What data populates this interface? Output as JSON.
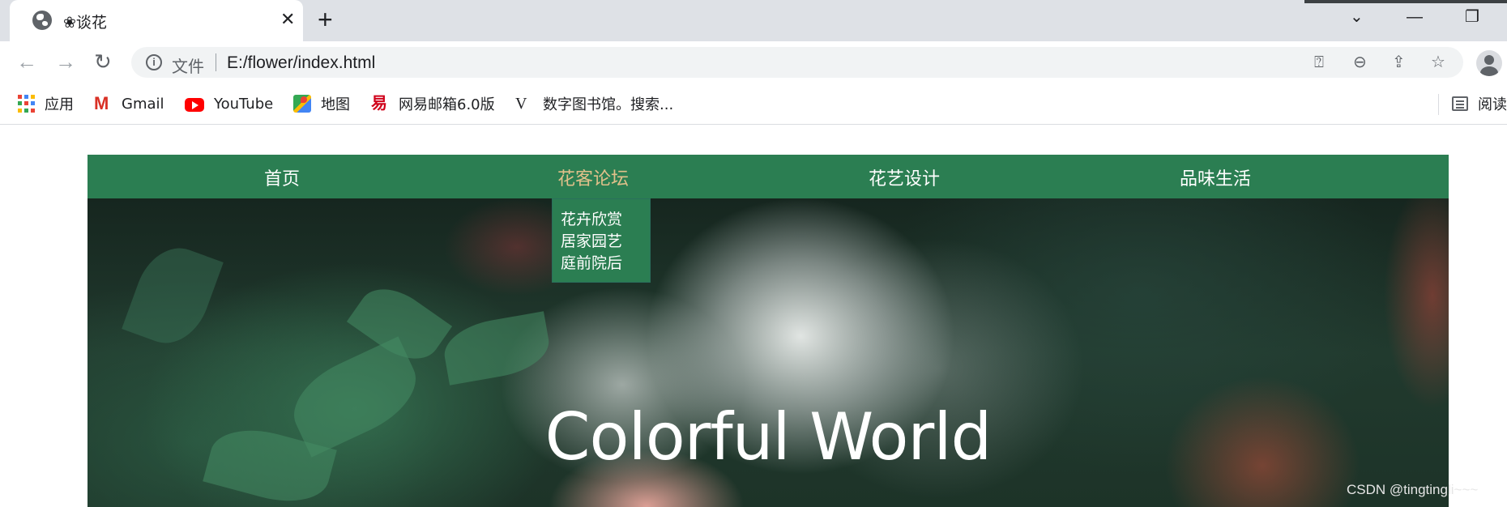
{
  "browser": {
    "tab": {
      "title": "❀谈花",
      "close": "✕"
    },
    "new_tab": "+",
    "window_controls": {
      "tab_search": "⌄",
      "minimize": "—",
      "restore": "❐"
    },
    "nav": {
      "back": "←",
      "forward": "→",
      "reload": "↻"
    },
    "address": {
      "info": "i",
      "file_label": "文件",
      "url": "E:/flower/index.html"
    },
    "omnibox_icons": {
      "translate": "⍰",
      "zoom": "⊖",
      "share": "⇪",
      "bookmark": "☆"
    },
    "bookmarks": [
      {
        "label": "应用",
        "icon": "apps-grid-icon"
      },
      {
        "label": "Gmail",
        "icon": "gmail-icon",
        "glyph": "M"
      },
      {
        "label": "YouTube",
        "icon": "youtube-icon"
      },
      {
        "label": "地图",
        "icon": "maps-icon"
      },
      {
        "label": "网易邮箱6.0版",
        "icon": "mail163-icon",
        "glyph": "易"
      },
      {
        "label": "数字图书馆。搜索...",
        "icon": "library-icon",
        "glyph": "V"
      }
    ],
    "reading_list": {
      "label": "阅读",
      "icon": "reading-list-icon"
    },
    "app_grid_colors": [
      "#ea4335",
      "#4285f4",
      "#fbbc04",
      "#34a853",
      "#ea4335",
      "#4285f4",
      "#fbbc04",
      "#34a853",
      "#ea4335"
    ]
  },
  "site": {
    "nav": [
      {
        "label": "首页",
        "active": false
      },
      {
        "label": "花客论坛",
        "active": true
      },
      {
        "label": "花艺设计",
        "active": false
      },
      {
        "label": "品味生活",
        "active": false
      }
    ],
    "dropdown": [
      "花卉欣赏",
      "居家园艺",
      "庭前院后"
    ],
    "hero_title": "Colorful World",
    "watermark": "CSDN @tingtingli~~~",
    "colors": {
      "nav_bg": "#2b7e52",
      "active_link": "#e0c08a",
      "link": "#ffffff"
    }
  }
}
